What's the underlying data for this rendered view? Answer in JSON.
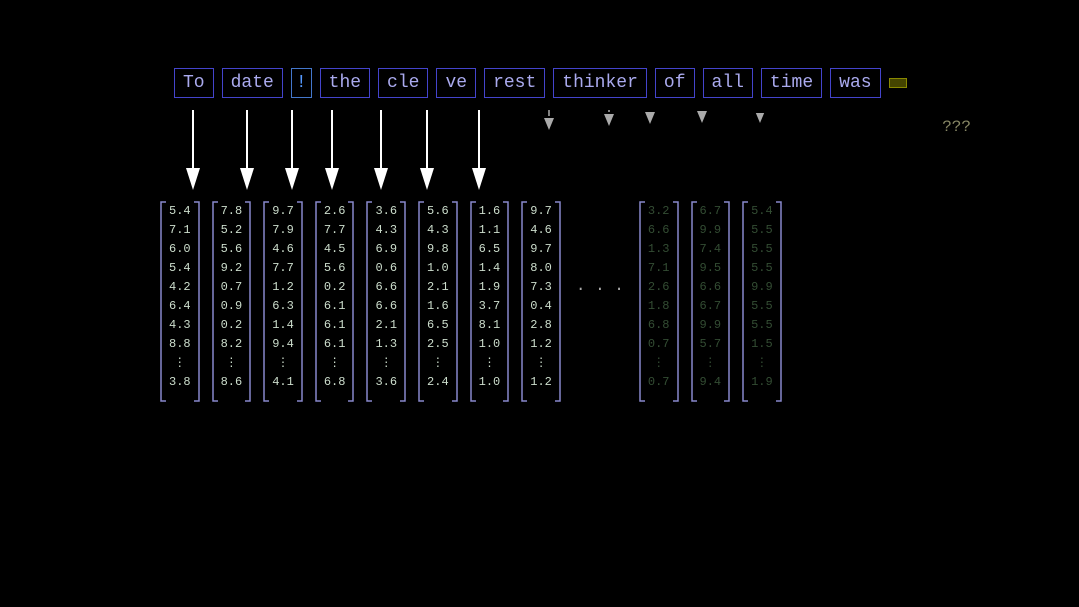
{
  "words": [
    {
      "id": "to",
      "text": "To",
      "style": "normal"
    },
    {
      "id": "date",
      "text": "date",
      "style": "normal"
    },
    {
      "id": "exclaim",
      "text": "!",
      "style": "exclaim"
    },
    {
      "id": "the",
      "text": "the",
      "style": "normal"
    },
    {
      "id": "cle",
      "text": "cle",
      "style": "normal"
    },
    {
      "id": "ve",
      "text": "ve",
      "style": "normal"
    },
    {
      "id": "rest",
      "text": "rest",
      "style": "normal"
    },
    {
      "id": "thinker",
      "text": "thinker",
      "style": "normal"
    },
    {
      "id": "of",
      "text": "of",
      "style": "normal"
    },
    {
      "id": "all",
      "text": "all",
      "style": "normal"
    },
    {
      "id": "time",
      "text": "time",
      "style": "normal"
    },
    {
      "id": "was",
      "text": "was",
      "style": "normal"
    },
    {
      "id": "answer",
      "text": "     ",
      "style": "answer"
    }
  ],
  "question_marks": "???",
  "matrices": [
    {
      "id": "m1",
      "values": [
        "5.4",
        "7.1",
        "6.0",
        "5.4",
        "4.2",
        "6.4",
        "4.3",
        "8.8",
        "⋮",
        "3.8"
      ],
      "dim": false
    },
    {
      "id": "m2",
      "values": [
        "7.8",
        "5.2",
        "5.6",
        "9.2",
        "0.7",
        "0.9",
        "0.2",
        "8.2",
        "⋮",
        "8.6"
      ],
      "dim": false
    },
    {
      "id": "m3",
      "values": [
        "9.7",
        "7.9",
        "4.6",
        "7.7",
        "1.2",
        "6.3",
        "1.4",
        "9.4",
        "⋮",
        "4.1"
      ],
      "dim": false
    },
    {
      "id": "m4",
      "values": [
        "2.6",
        "7.7",
        "4.5",
        "5.6",
        "0.2",
        "6.1",
        "6.1",
        "6.1",
        "⋮",
        "6.8"
      ],
      "dim": false
    },
    {
      "id": "m5",
      "values": [
        "3.6",
        "4.3",
        "6.9",
        "0.6",
        "6.6",
        "6.6",
        "2.1",
        "1.3",
        "⋮",
        "3.6"
      ],
      "dim": false
    },
    {
      "id": "m6",
      "values": [
        "5.6",
        "4.3",
        "9.8",
        "1.0",
        "2.1",
        "1.6",
        "6.5",
        "2.5",
        "⋮",
        "2.4"
      ],
      "dim": false
    },
    {
      "id": "m7",
      "values": [
        "1.6",
        "1.1",
        "6.5",
        "1.4",
        "1.9",
        "3.7",
        "8.1",
        "1.0",
        "⋮",
        "1.0"
      ],
      "dim": false
    },
    {
      "id": "m8",
      "values": [
        "9.7",
        "4.6",
        "9.7",
        "8.0",
        "7.3",
        "0.4",
        "2.8",
        "1.2",
        "⋮",
        "1.2"
      ],
      "dim": false
    },
    {
      "id": "ellipsis",
      "values": [],
      "dim": false,
      "isEllipsis": true
    },
    {
      "id": "m9",
      "values": [
        "3.2",
        "6.6",
        "1.3",
        "7.1",
        "2.6",
        "1.8",
        "6.8",
        "0.7",
        "⋮",
        "0.7"
      ],
      "dim": true
    },
    {
      "id": "m10",
      "values": [
        "6.7",
        "9.9",
        "7.4",
        "9.5",
        "6.6",
        "6.7",
        "9.9",
        "5.7",
        "⋮",
        "9.4"
      ],
      "dim": true
    },
    {
      "id": "m11",
      "values": [
        "5.4",
        "5.5",
        "5.5",
        "5.5",
        "9.9",
        "5.5",
        "5.5",
        "1.5",
        "⋮",
        "1.9"
      ],
      "dim": true
    }
  ]
}
